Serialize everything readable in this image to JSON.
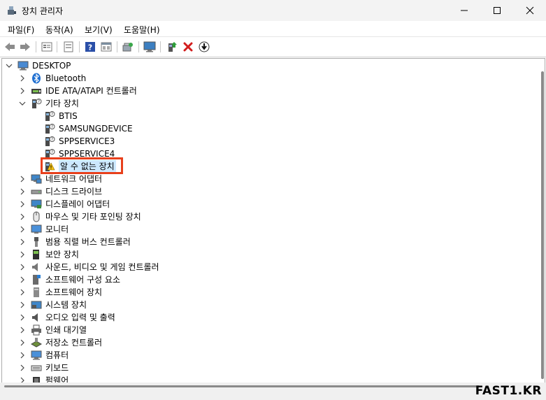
{
  "window": {
    "title": "장치 관리자"
  },
  "menu": [
    "파일(F)",
    "동작(A)",
    "보기(V)",
    "도움말(H)"
  ],
  "toolbar": [
    "back-icon",
    "forward-icon",
    "properties-icon",
    "show-hidden-icon",
    "help-icon",
    "view-icon",
    "scan-hardware-icon",
    "monitor-icon",
    "enable-icon",
    "uninstall-icon",
    "update-driver-icon"
  ],
  "tree": {
    "root": "DESKTOP",
    "items": [
      {
        "label": "Bluetooth",
        "icon": "bluetooth-icon",
        "level": 1,
        "state": "collapsed"
      },
      {
        "label": "IDE ATA/ATAPI 컨트롤러",
        "icon": "ide-controller-icon",
        "level": 1,
        "state": "collapsed"
      },
      {
        "label": "기타 장치",
        "icon": "other-device-icon",
        "level": 1,
        "state": "expanded"
      },
      {
        "label": "BTIS",
        "icon": "unknown-device-icon",
        "level": 2
      },
      {
        "label": "SAMSUNGDEVICE",
        "icon": "unknown-device-icon",
        "level": 2
      },
      {
        "label": "SPPSERVICE3",
        "icon": "unknown-device-icon",
        "level": 2
      },
      {
        "label": "SPPSERVICE4",
        "icon": "unknown-device-icon",
        "level": 2
      },
      {
        "label": "알 수 없는 장치",
        "icon": "warning-device-icon",
        "level": 2,
        "selected": true
      },
      {
        "label": "네트워크 어댑터",
        "icon": "network-adapter-icon",
        "level": 1,
        "state": "collapsed"
      },
      {
        "label": "디스크 드라이브",
        "icon": "disk-drive-icon",
        "level": 1,
        "state": "collapsed"
      },
      {
        "label": "디스플레이 어댑터",
        "icon": "display-adapter-icon",
        "level": 1,
        "state": "collapsed"
      },
      {
        "label": "마우스 및 기타 포인팅 장치",
        "icon": "mouse-icon",
        "level": 1,
        "state": "collapsed"
      },
      {
        "label": "모니터",
        "icon": "monitor-icon",
        "level": 1,
        "state": "collapsed"
      },
      {
        "label": "범용 직렬 버스 컨트롤러",
        "icon": "usb-icon",
        "level": 1,
        "state": "collapsed"
      },
      {
        "label": "보안 장치",
        "icon": "security-device-icon",
        "level": 1,
        "state": "collapsed"
      },
      {
        "label": "사운드, 비디오 및 게임 컨트롤러",
        "icon": "sound-icon",
        "level": 1,
        "state": "collapsed"
      },
      {
        "label": "소프트웨어 구성 요소",
        "icon": "software-component-icon",
        "level": 1,
        "state": "collapsed"
      },
      {
        "label": "소프트웨어 장치",
        "icon": "software-device-icon",
        "level": 1,
        "state": "collapsed"
      },
      {
        "label": "시스템 장치",
        "icon": "system-device-icon",
        "level": 1,
        "state": "collapsed"
      },
      {
        "label": "오디오 입력 및 출력",
        "icon": "audio-io-icon",
        "level": 1,
        "state": "collapsed"
      },
      {
        "label": "인쇄 대기열",
        "icon": "printer-icon",
        "level": 1,
        "state": "collapsed"
      },
      {
        "label": "저장소 컨트롤러",
        "icon": "storage-controller-icon",
        "level": 1,
        "state": "collapsed"
      },
      {
        "label": "컴퓨터",
        "icon": "computer-icon",
        "level": 1,
        "state": "collapsed"
      },
      {
        "label": "키보드",
        "icon": "keyboard-icon",
        "level": 1,
        "state": "collapsed"
      },
      {
        "label": "펌웨어",
        "icon": "firmware-icon",
        "level": 1,
        "state": "collapsed"
      }
    ]
  },
  "watermark": "FAST1.KR",
  "colors": {
    "highlight": "#e8401c",
    "selection": "#cce8ff"
  }
}
